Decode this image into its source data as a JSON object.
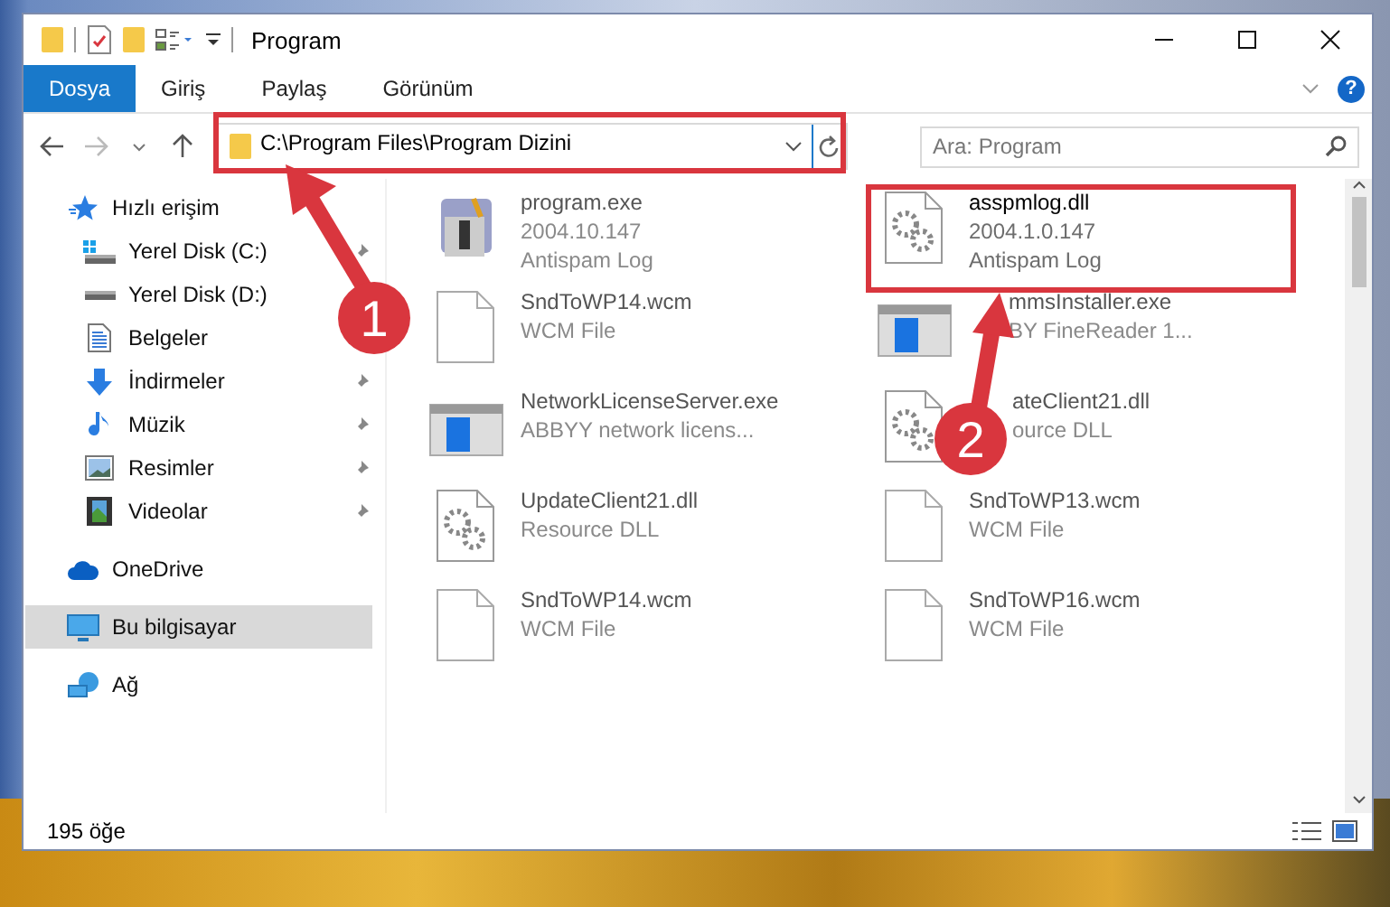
{
  "window": {
    "title": "Program"
  },
  "ribbon": {
    "tabs": [
      {
        "label": "Dosya",
        "kind": "menu"
      },
      {
        "label": "Giriş",
        "kind": "tab"
      },
      {
        "label": "Paylaş",
        "kind": "tab"
      },
      {
        "label": "Görünüm",
        "kind": "tab"
      }
    ],
    "help": "?"
  },
  "address": {
    "path": "C:\\Program Files\\Program Dizini"
  },
  "search": {
    "placeholder": "Ara: Program"
  },
  "sidebar": {
    "items": [
      {
        "label": "Hızlı erişim",
        "selected": false,
        "children": [
          {
            "label": "Yerel Disk (C:)",
            "pinned": true,
            "selected": false
          },
          {
            "label": "Yerel Disk (D:)",
            "selected": false
          },
          {
            "label": "Belgeler",
            "selected": false
          },
          {
            "label": "İndirmeler",
            "pinned": true,
            "selected": false
          },
          {
            "label": "Müzik",
            "pinned": true,
            "selected": false
          },
          {
            "label": "Resimler",
            "pinned": true,
            "selected": false
          },
          {
            "label": "Videolar",
            "pinned": true,
            "selected": false
          }
        ]
      },
      {
        "label": "OneDrive",
        "selected": false
      },
      {
        "label": "Bu bilgisayar",
        "selected": true
      },
      {
        "label": "Ağ",
        "selected": false
      }
    ]
  },
  "files": [
    {
      "name": "program.exe",
      "lines": [
        "2004.10.147",
        "Antispam Log"
      ],
      "kind": "installer"
    },
    {
      "name": "asspmlog.dll",
      "lines": [
        "2004.1.0.147",
        "Antispam Log"
      ],
      "kind": "dll"
    },
    {
      "name": "SndToWP14.wcm",
      "lines": [
        "WCM File"
      ],
      "kind": "blank"
    },
    {
      "name": "mmsInstaller.exe",
      "lines": [
        "BY FineReader 1..."
      ],
      "kind": "window"
    },
    {
      "name": "NetworkLicenseServer.exe",
      "lines": [
        "ABBYY network licens..."
      ],
      "kind": "window"
    },
    {
      "name": "ateClient21.dll",
      "lines": [
        "ource DLL"
      ],
      "kind": "dll"
    },
    {
      "name": "UpdateClient21.dll",
      "lines": [
        "Resource DLL"
      ],
      "kind": "dll"
    },
    {
      "name": "SndToWP13.wcm",
      "lines": [
        "WCM File"
      ],
      "kind": "blank"
    },
    {
      "name": "SndToWP14.wcm",
      "lines": [
        "WCM File"
      ],
      "kind": "blank"
    },
    {
      "name": "SndToWP16.wcm",
      "lines": [
        "WCM File"
      ],
      "kind": "blank"
    }
  ],
  "status_bar": {
    "count": "195 öğe"
  },
  "annotations": [
    {
      "number": "1"
    },
    {
      "number": "2"
    }
  ]
}
